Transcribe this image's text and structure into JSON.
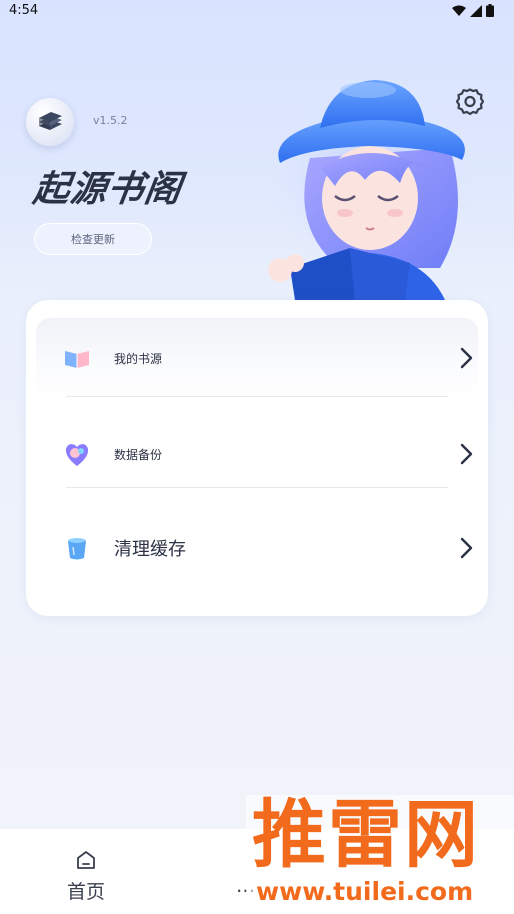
{
  "status_bar": {
    "time": "4:54"
  },
  "header": {
    "version": "v1.5.2",
    "app_title": "起源书阁",
    "check_update_label": "检查更新"
  },
  "menu": {
    "items": [
      {
        "label": "我的书源",
        "icon": "book-open-icon"
      },
      {
        "label": "数据备份",
        "icon": "heart-backup-icon"
      },
      {
        "label": "清理缓存",
        "icon": "trash-can-icon"
      }
    ]
  },
  "tabbar": {
    "home_label": "首页",
    "second_label": "…"
  },
  "watermark": {
    "brand": "推雷网",
    "url": "www.tuilei.com"
  },
  "colors": {
    "accent_blue": "#4a7cf5",
    "title_dark": "#2b3245",
    "watermark_orange": "#f26a1b"
  }
}
